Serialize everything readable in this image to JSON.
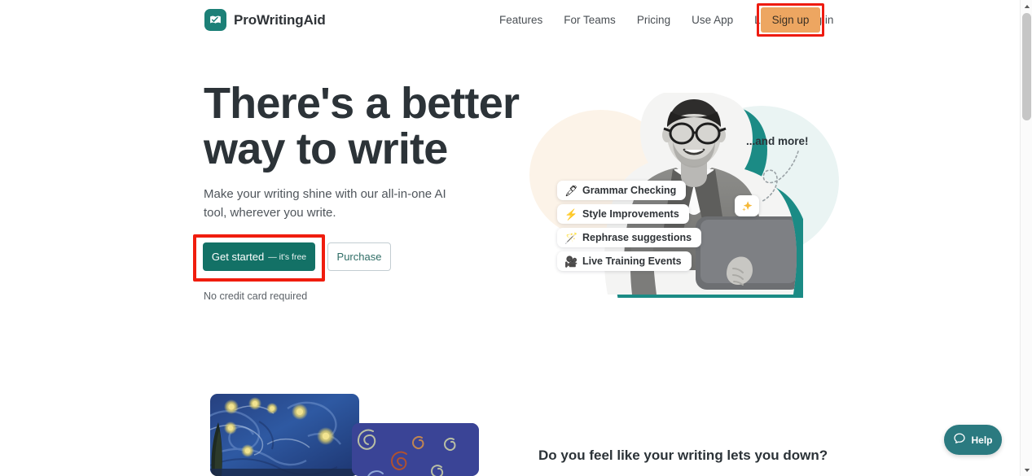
{
  "brand": {
    "name": "ProWritingAid",
    "mark_icon": "open-book-check-icon",
    "mark_color": "#1c8077"
  },
  "nav": {
    "links": [
      {
        "label": "Features"
      },
      {
        "label": "For Teams"
      },
      {
        "label": "Pricing"
      },
      {
        "label": "Use App"
      },
      {
        "label": "Learn"
      },
      {
        "label": "Log in"
      }
    ],
    "signup": {
      "label": "Sign up",
      "bg_color": "#eda661",
      "highlight_color": "#ee1b10"
    }
  },
  "hero": {
    "title": "There's a better way to write",
    "subtitle": "Make your writing shine with our all-in-one AI tool, wherever you write.",
    "primary_cta": {
      "label": "Get started",
      "suffix": "— it's free",
      "bg_color": "#137166",
      "highlight_color": "#f01d0e"
    },
    "secondary_cta": {
      "label": "Purchase",
      "text_color": "#2f6d66"
    },
    "note": "No credit card required",
    "and_more_label": "...and more!",
    "sparkle_icon": "sparkles-icon",
    "chips": [
      {
        "icon": "pen-icon",
        "glyph": "🖋",
        "label": "Grammar Checking"
      },
      {
        "icon": "lightning-bolt-icon",
        "glyph": "⚡",
        "label": "Style Improvements"
      },
      {
        "icon": "magic-wand-icon",
        "glyph": "🪄",
        "label": "Rephrase suggestions"
      },
      {
        "icon": "movie-camera-icon",
        "glyph": "🎥",
        "label": "Live Training Events"
      }
    ]
  },
  "bottom": {
    "question": "Do you feel like your writing lets you down?",
    "artwork_primary": "starry-night-painting",
    "artwork_secondary": "blue-swirls-illustration"
  },
  "help_widget": {
    "label": "Help",
    "icon": "chat-bubble-icon",
    "bg_color": "#2b7a80"
  },
  "scrollbar": {
    "up_arrow_icon": "chevron-up-icon",
    "down_arrow_icon": "chevron-down-icon"
  }
}
